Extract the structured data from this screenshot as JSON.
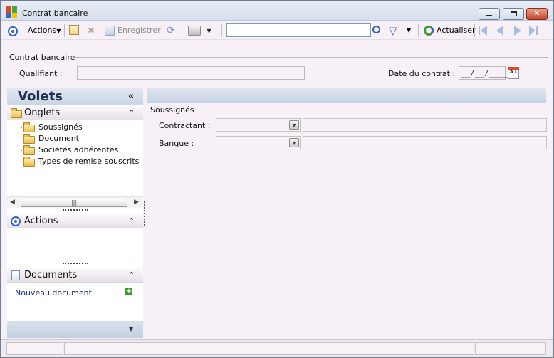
{
  "window": {
    "title": "Contrat bancaire",
    "controls": [
      "minimize",
      "maximize",
      "close"
    ]
  },
  "toolbar": {
    "actions_label": "Actions",
    "save_label": "Enregistrer",
    "search_value": "",
    "refresh_label": "Actualiser",
    "icons": [
      "target-icon",
      "new-doc-icon",
      "delete-icon",
      "save-icon",
      "sync-icon",
      "print-icon",
      "search-icon",
      "filter-icon",
      "refresh-icon",
      "first-icon",
      "prev-icon",
      "next-icon",
      "last-icon"
    ]
  },
  "contract": {
    "section_title": "Contrat bancaire",
    "qualifiant_label": "Qualifiant :",
    "qualifiant_value": "",
    "date_label": "Date du contrat :",
    "date_value": "__/__/____",
    "calendar_day": "31"
  },
  "side": {
    "title": "Volets",
    "onglets": {
      "title": "Onglets",
      "items": [
        "Soussignés",
        "Document",
        "Sociétés adhérentes",
        "Types de remise souscrits"
      ]
    },
    "actions_title": "Actions",
    "documents": {
      "title": "Documents",
      "new_label": "Nouveau document"
    }
  },
  "main": {
    "section_title": "Soussignés",
    "contractant_label": "Contractant :",
    "banque_label": "Banque :"
  },
  "colors": {
    "background": "#f7f1f7",
    "pane_header": "#c9d4e4",
    "link": "#1a2f8a"
  }
}
